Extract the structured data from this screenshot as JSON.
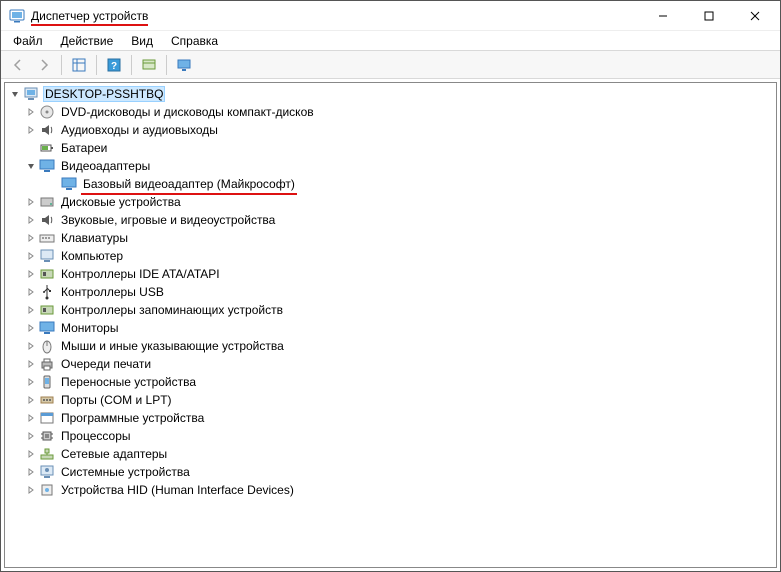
{
  "window": {
    "title": "Диспетчер устройств"
  },
  "menu": {
    "file": "Файл",
    "action": "Действие",
    "view": "Вид",
    "help": "Справка"
  },
  "tree": {
    "root": "DESKTOP-PSSHTBQ",
    "items": [
      {
        "label": "DVD-дисководы и дисководы компакт-дисков",
        "icon": "disc"
      },
      {
        "label": "Аудиовходы и аудиовыходы",
        "icon": "audio"
      },
      {
        "label": "Батареи",
        "icon": "battery",
        "noexpand": true
      },
      {
        "label": "Видеоадаптеры",
        "icon": "monitor",
        "expanded": true,
        "children": [
          {
            "label": "Базовый видеоадаптер (Майкрософт)",
            "icon": "monitor",
            "underline": true
          }
        ]
      },
      {
        "label": "Дисковые устройства",
        "icon": "drive"
      },
      {
        "label": "Звуковые, игровые и видеоустройства",
        "icon": "audio"
      },
      {
        "label": "Клавиатуры",
        "icon": "keyboard"
      },
      {
        "label": "Компьютер",
        "icon": "computer"
      },
      {
        "label": "Контроллеры IDE ATA/ATAPI",
        "icon": "controller"
      },
      {
        "label": "Контроллеры USB",
        "icon": "usb"
      },
      {
        "label": "Контроллеры запоминающих устройств",
        "icon": "controller"
      },
      {
        "label": "Мониторы",
        "icon": "monitor"
      },
      {
        "label": "Мыши и иные указывающие устройства",
        "icon": "mouse"
      },
      {
        "label": "Очереди печати",
        "icon": "printer"
      },
      {
        "label": "Переносные устройства",
        "icon": "portable"
      },
      {
        "label": "Порты (COM и LPT)",
        "icon": "port"
      },
      {
        "label": "Программные устройства",
        "icon": "software"
      },
      {
        "label": "Процессоры",
        "icon": "cpu"
      },
      {
        "label": "Сетевые адаптеры",
        "icon": "network"
      },
      {
        "label": "Системные устройства",
        "icon": "system"
      },
      {
        "label": "Устройства HID (Human Interface Devices)",
        "icon": "hid"
      }
    ]
  }
}
